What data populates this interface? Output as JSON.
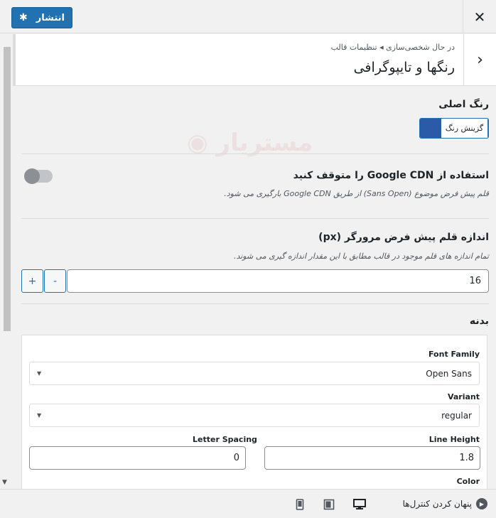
{
  "topbar": {
    "close_label": "✕",
    "publish_label": "انتشار",
    "publish_icon": "gear-icon"
  },
  "header": {
    "breadcrumb": "در حال شخصی‌سازی ◂ تنظیمات قالب",
    "title": "رنگها و تایپوگرافی",
    "back_icon": "chevron-right-icon"
  },
  "main_color": {
    "title": "رنگ اصلی",
    "picker_label": "گزینش رنگ",
    "color": "#2b5aa8"
  },
  "google_cdn": {
    "title": "استفاده از Google CDN را متوقف کنید",
    "description": "قلم پیش فرض موضوع (Sans Open) از طریق Google CDN بارگیری می شود.",
    "enabled": false
  },
  "font_size": {
    "title": "اندازه قلم پیش فرض مرورگر (px)",
    "description": "تمام اندازه های قلم موجود در قالب مطابق با این مقدار اندازه گیری می شوند.",
    "value": "16",
    "minus": "-",
    "plus": "+"
  },
  "body_typography": {
    "title": "بدنه",
    "font_family_label": "Font Family",
    "font_family_value": "Open Sans",
    "variant_label": "Variant",
    "variant_value": "regular",
    "line_height_label": "Line Height",
    "line_height_value": "1.8",
    "letter_spacing_label": "Letter Spacing",
    "letter_spacing_value": "0",
    "color_label": "Color"
  },
  "footer": {
    "hide_controls_label": "پنهان کردن کنترل‌ها"
  },
  "colors": {
    "accent": "#2271b1",
    "toggle_off": "#8c8f94"
  }
}
